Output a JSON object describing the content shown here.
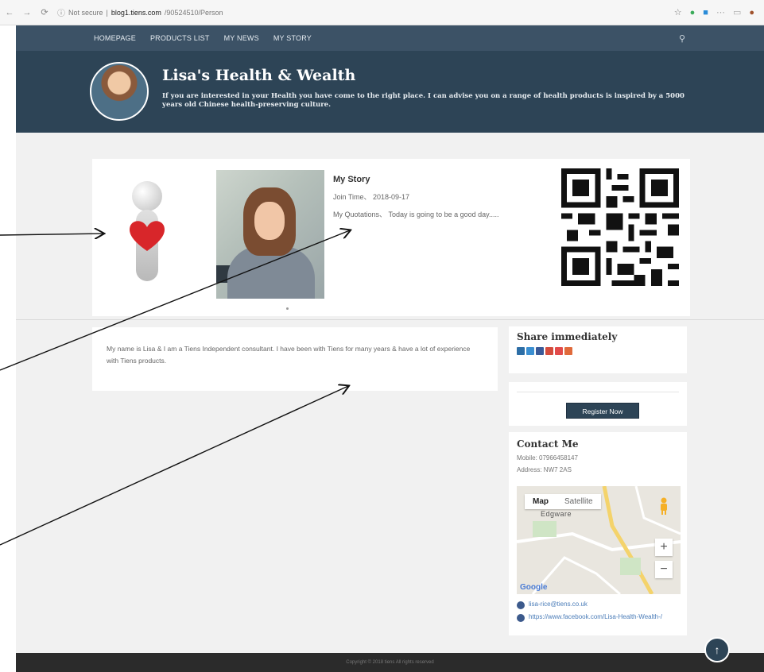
{
  "browser": {
    "url_security": "Not secure",
    "url_host": "blog1.tiens.com",
    "url_path": "/90524510/Person"
  },
  "nav": {
    "items": [
      "HOMEPAGE",
      "PRODUCTS LIST",
      "MY NEWS",
      "MY STORY"
    ]
  },
  "banner": {
    "title": "Lisa's Health & Wealth",
    "description": "If you are interested in your Health you have come to the right place. I can advise you on a range of health products is inspired by a 5000 years old Chinese health-preserving culture."
  },
  "profile": {
    "story_title": "My Story",
    "join_time": "Join Time、 2018-09-17",
    "quotation": "My Quotations、 Today is going to be a good day....."
  },
  "bio": {
    "text": "My name is Lisa & I am a Tiens Independent consultant. I have been with Tiens for many years & have a lot of experience with Tiens products."
  },
  "share": {
    "heading": "Share immediately",
    "icons": [
      "linkedin-icon",
      "twitter-icon",
      "facebook-icon",
      "google-plus-icon",
      "weibo-icon",
      "more-icon"
    ],
    "colors": [
      "#2d6ea6",
      "#3b8fd1",
      "#3a5a98",
      "#d44c3d",
      "#e24b4b",
      "#e06a3b"
    ]
  },
  "register": {
    "button": "Register Now"
  },
  "contact": {
    "heading": "Contact Me",
    "mobile": "Mobile: 07966458147",
    "address": "Address: NW7 2AS",
    "email": "lisa-rice@tiens.co.uk",
    "facebook": "https://www.facebook.com/Lisa-Health-Wealth-/"
  },
  "map": {
    "tab_map": "Map",
    "tab_satellite": "Satellite",
    "place": "Edgware",
    "zoom_in": "+",
    "zoom_out": "−",
    "brand": "Google"
  },
  "footer": {
    "text": "Copyright © 2018 tiens All rights reserved"
  },
  "colors": {
    "nav": "#3c5266",
    "banner": "#2d4456",
    "page_bg": "#f1f1f1",
    "footer": "#2b2b2b"
  }
}
